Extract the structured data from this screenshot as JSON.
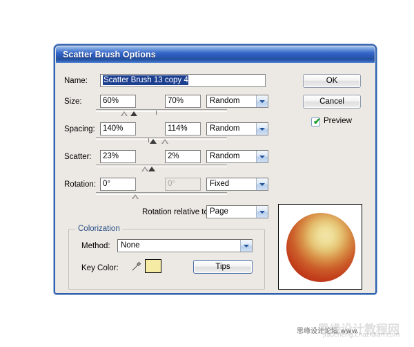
{
  "dialog": {
    "title": "Scatter Brush Options"
  },
  "fields": {
    "name_label": "Name:",
    "name_value": "Scatter Brush 13 copy 4",
    "rows": [
      {
        "label": "Size:",
        "value1": "60%",
        "value2": "70%",
        "mode": "Random",
        "disabled2": false
      },
      {
        "label": "Spacing:",
        "value1": "140%",
        "value2": "114%",
        "mode": "Random",
        "disabled2": false
      },
      {
        "label": "Scatter:",
        "value1": "23%",
        "value2": "2%",
        "mode": "Random",
        "disabled2": false
      },
      {
        "label": "Rotation:",
        "value1": "0°",
        "value2": "0°",
        "mode": "Fixed",
        "disabled2": true
      }
    ],
    "rotation_relative_label": "Rotation relative to:",
    "rotation_relative_value": "Page"
  },
  "colorization": {
    "group_title": "Colorization",
    "method_label": "Method:",
    "method_value": "None",
    "key_color_label": "Key Color:",
    "key_color_hex": "#f6eba4",
    "tips_label": "Tips"
  },
  "buttons": {
    "ok": "OK",
    "cancel": "Cancel",
    "preview_label": "Preview",
    "preview_checked": true,
    "checkmark": "✔"
  },
  "preview": {
    "sphere_highlight": "#f3e5a8",
    "sphere_edge": "#a4260f"
  },
  "watermark": {
    "main": "思缘设计论坛 www.",
    "ghost": "思缘设计教程网",
    "sub": "jiaocheng.chazidian.com"
  }
}
